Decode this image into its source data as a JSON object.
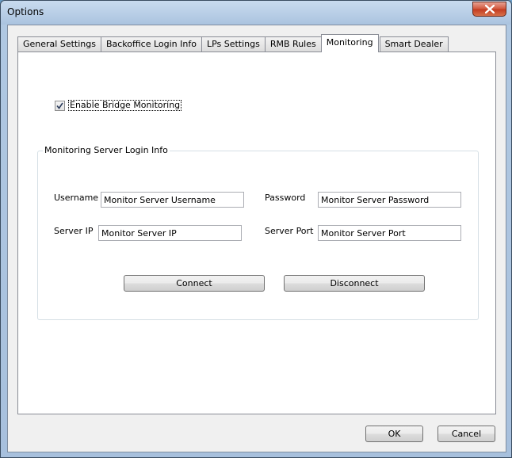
{
  "window": {
    "title": "Options",
    "close_icon": "close-icon"
  },
  "tabs": [
    {
      "label": "General Settings",
      "active": false
    },
    {
      "label": "Backoffice Login Info",
      "active": false
    },
    {
      "label": "LPs Settings",
      "active": false
    },
    {
      "label": "RMB Rules",
      "active": false
    },
    {
      "label": "Monitoring",
      "active": true
    },
    {
      "label": "Smart Dealer",
      "active": false
    }
  ],
  "monitoring": {
    "enable_checkbox": {
      "label": "Enable Bridge Monitoring",
      "checked": true
    },
    "group_title": "Monitoring Server Login Info",
    "fields": {
      "username": {
        "label": "Username",
        "value": "Monitor Server Username"
      },
      "password": {
        "label": "Password",
        "value": "Monitor Server Password"
      },
      "server_ip": {
        "label": "Server IP",
        "value": "Monitor Server IP"
      },
      "server_port": {
        "label": "Server Port",
        "value": "Monitor Server Port"
      }
    },
    "connect_label": "Connect",
    "disconnect_label": "Disconnect"
  },
  "footer": {
    "ok_label": "OK",
    "cancel_label": "Cancel"
  }
}
